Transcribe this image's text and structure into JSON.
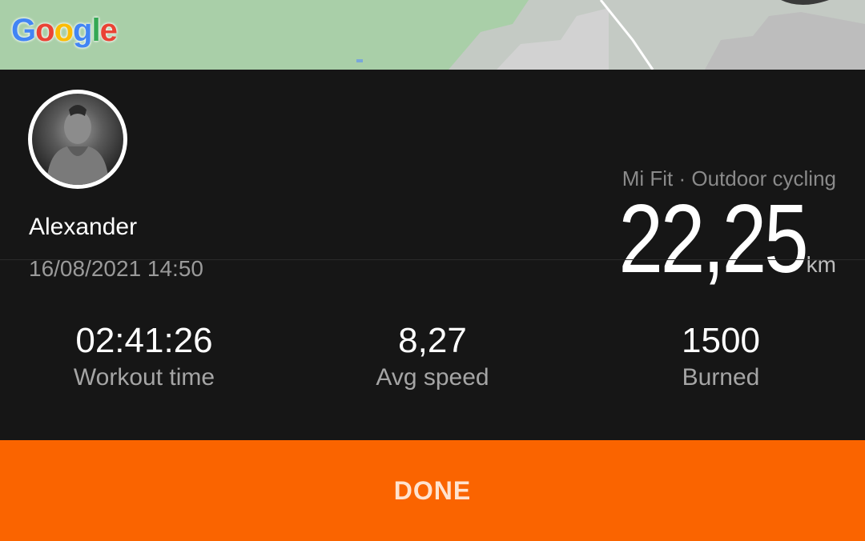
{
  "map": {
    "colors": {
      "land": "#a9cfa8",
      "urban": "#c9c9c9",
      "road": "#ffffff"
    },
    "attribution_logo": [
      "G",
      "o",
      "o",
      "g",
      "l",
      "e"
    ]
  },
  "user": {
    "name": "Alexander",
    "date": "16/08/2021 14:50"
  },
  "activity": {
    "source": "Mi Fit · Outdoor cycling",
    "distance": "22,25",
    "distance_unit": "km"
  },
  "stats": [
    {
      "value": "02:41:26",
      "label": "Workout time"
    },
    {
      "value": "8,27",
      "label": "Avg speed"
    },
    {
      "value": "1500",
      "label": "Burned"
    }
  ],
  "actions": {
    "done_label": "DONE"
  },
  "colors": {
    "accent": "#fa6400",
    "background": "#161616"
  }
}
